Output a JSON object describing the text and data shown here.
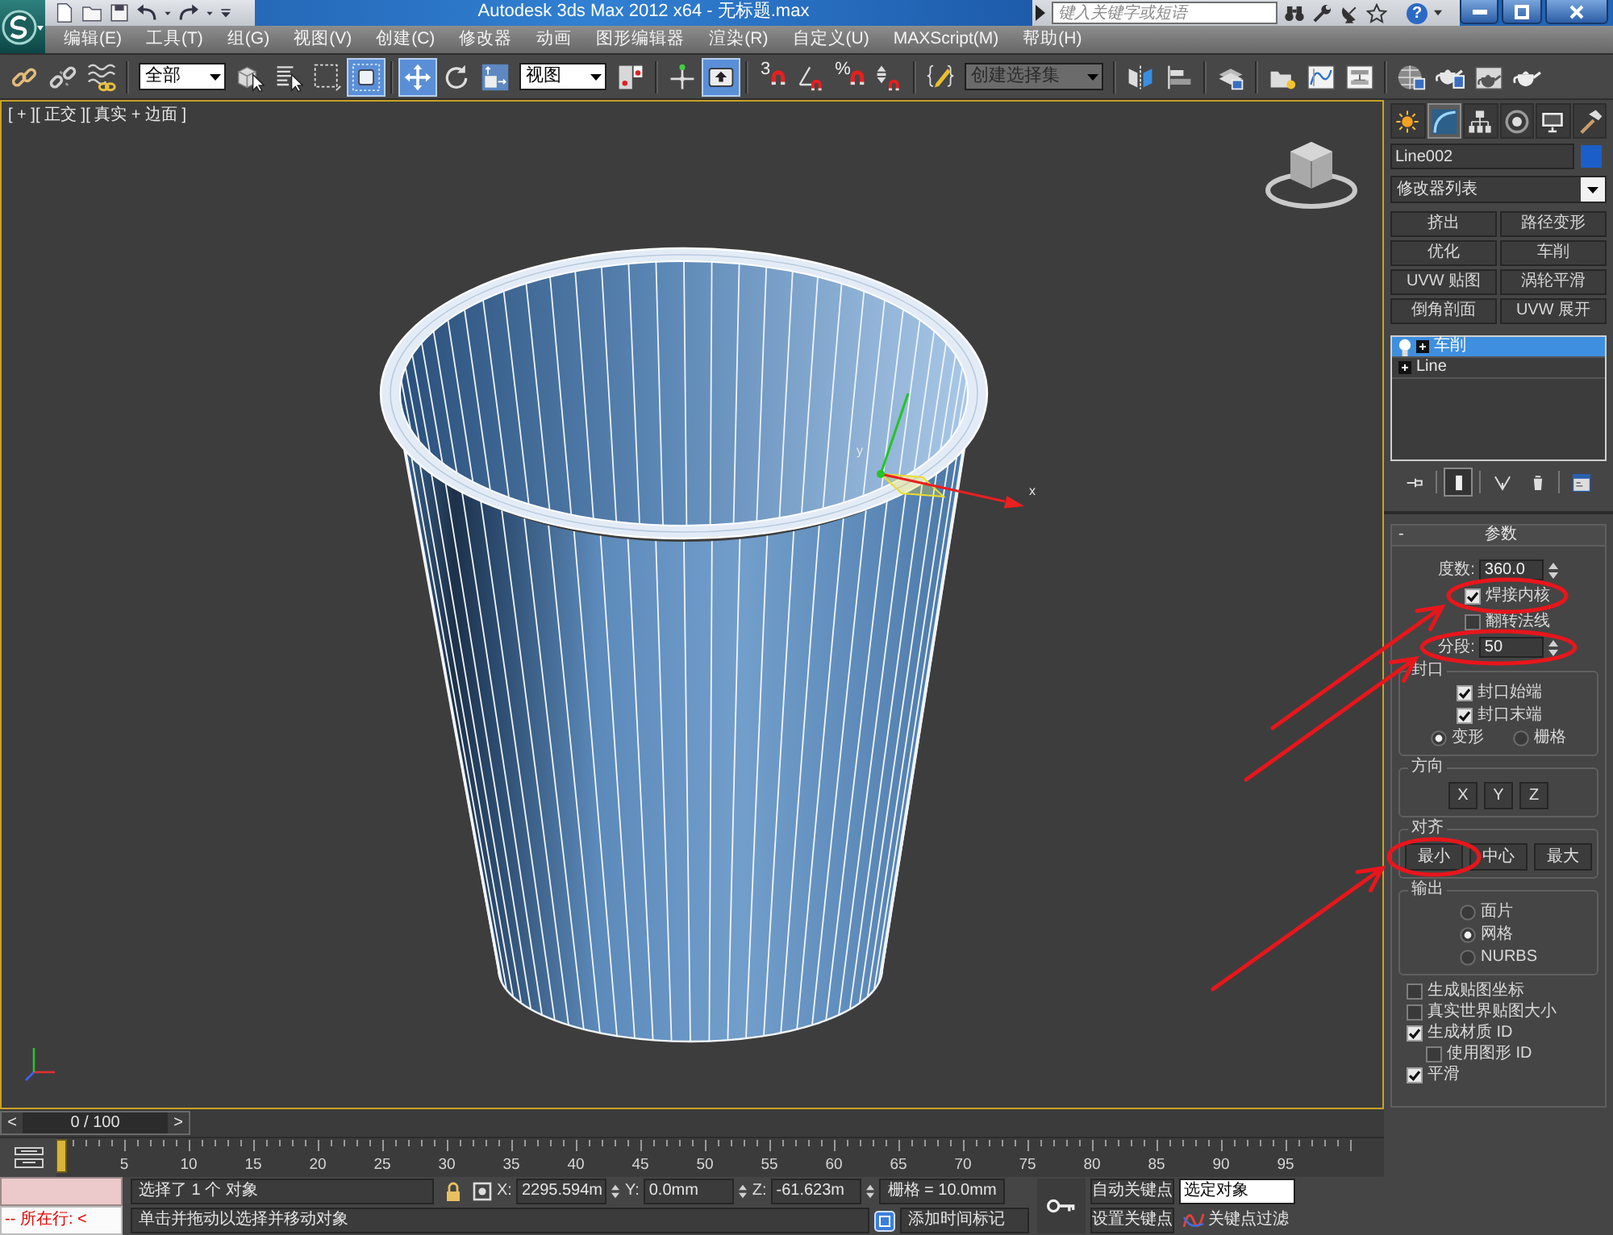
{
  "title_bar": {
    "title": "Autodesk 3ds Max  2012 x64 - 无标题.max",
    "search": {
      "placeholder": "键入关键字或短语"
    },
    "help": "?"
  },
  "menu": [
    "编辑(E)",
    "工具(T)",
    "组(G)",
    "视图(V)",
    "创建(C)",
    "修改器",
    "动画",
    "图形编辑器",
    "渲染(R)",
    "自定义(U)",
    "MAXScript(M)",
    "帮助(H)"
  ],
  "toolbar": {
    "groups": [
      [
        {
          "kind": "link",
          "on": false
        },
        {
          "kind": "unlink",
          "on": false
        },
        {
          "kind": "bind",
          "on": false
        }
      ],
      [
        {
          "kind": "dropdown",
          "value": "全部"
        },
        {
          "kind": "select",
          "on": false
        },
        {
          "kind": "select-by-name",
          "on": false
        },
        {
          "kind": "region",
          "on": false
        },
        {
          "kind": "window-crossing",
          "on": true
        }
      ],
      [
        {
          "kind": "move",
          "on": true
        },
        {
          "kind": "rotate",
          "on": false
        },
        {
          "kind": "scale",
          "on": false
        },
        {
          "kind": "dropdown",
          "value": "视图"
        },
        {
          "kind": "pivot",
          "on": false
        }
      ],
      [
        {
          "kind": "manipulate",
          "on": false
        },
        {
          "kind": "shortcut-override",
          "on": true
        }
      ],
      [
        {
          "kind": "snap",
          "label": "3",
          "on": false
        },
        {
          "kind": "angle-snap",
          "on": false
        },
        {
          "kind": "percent-snap",
          "label": "%",
          "on": false
        },
        {
          "kind": "spinner-snap",
          "on": false
        }
      ],
      [
        {
          "kind": "named-sets",
          "on": false
        },
        {
          "kind": "dropdown",
          "placeholder": "创建选择集"
        }
      ],
      [
        {
          "kind": "mirror",
          "on": false
        },
        {
          "kind": "align",
          "on": false
        }
      ],
      [
        {
          "kind": "layers",
          "on": false
        }
      ],
      [
        {
          "kind": "ribbon",
          "on": false
        },
        {
          "kind": "curve-editor",
          "on": false
        },
        {
          "kind": "schematic",
          "on": false
        }
      ],
      [
        {
          "kind": "material-editor",
          "on": false
        },
        {
          "kind": "render-setup",
          "on": false
        },
        {
          "kind": "frame-window",
          "on": false
        },
        {
          "kind": "render",
          "on": false
        }
      ]
    ]
  },
  "viewport": {
    "labels": [
      "[ + ]",
      "[ 正交 ]",
      "[ 真实 + 边面 ]"
    ],
    "gizmo_axes": [
      "x",
      "y"
    ]
  },
  "command_panel": {
    "tabs": [
      {
        "kind": "create",
        "selected": false
      },
      {
        "kind": "modify",
        "selected": true
      },
      {
        "kind": "hierarchy",
        "selected": false
      },
      {
        "kind": "motion",
        "selected": false
      },
      {
        "kind": "display",
        "selected": false
      },
      {
        "kind": "utilities",
        "selected": false
      }
    ],
    "object": {
      "name": "Line002",
      "color": "#1c5ec9"
    },
    "modifier_list": "修改器列表",
    "modifier_buttons": [
      "挤出",
      "路径变形",
      "优化",
      "车削",
      "UVW 贴图",
      "涡轮平滑",
      "倒角剖面",
      "UVW 展开"
    ],
    "stack": [
      {
        "kind": "modifier",
        "label": "车削",
        "selected": true,
        "expanded": false
      },
      {
        "kind": "object",
        "label": "Line",
        "selected": false,
        "expanded": false
      }
    ],
    "stack_tools": [
      {
        "kind": "pin",
        "on": false
      },
      {
        "kind": "end-result",
        "on": true
      },
      {
        "kind": "make-unique",
        "on": false
      },
      {
        "kind": "remove",
        "on": false
      },
      {
        "kind": "configure",
        "on": false
      }
    ],
    "rollout": {
      "toggle": "-",
      "title": "参数",
      "items": [
        {
          "kind": "spinner",
          "label": "度数:",
          "value": "360.0",
          "circled": false
        },
        {
          "kind": "checkbox",
          "label": "焊接内核",
          "checked": true,
          "circled": true
        },
        {
          "kind": "checkbox",
          "label": "翻转法线",
          "checked": false,
          "circled": false
        },
        {
          "kind": "spinner",
          "label": "分段:",
          "value": "50",
          "circled": true
        },
        {
          "kind": "group",
          "title": "封口",
          "items": [
            {
              "kind": "checkbox",
              "label": "封口始端",
              "checked": true,
              "circled": false
            },
            {
              "kind": "checkbox",
              "label": "封口末端",
              "checked": true,
              "circled": false
            },
            {
              "kind": "radio-row",
              "options": [
                {
                  "label": "变形",
                  "selected": true
                },
                {
                  "label": "栅格",
                  "selected": false
                }
              ]
            }
          ]
        },
        {
          "kind": "group",
          "title": "方向",
          "items": [
            {
              "kind": "buttons",
              "buttons": [
                {
                  "label": "X",
                  "circled": false
                },
                {
                  "label": "Y",
                  "circled": false
                },
                {
                  "label": "Z",
                  "circled": false
                }
              ]
            }
          ]
        },
        {
          "kind": "group",
          "title": "对齐",
          "items": [
            {
              "kind": "buttons",
              "buttons": [
                {
                  "label": "最小",
                  "circled": true
                },
                {
                  "label": "中心",
                  "circled": false
                },
                {
                  "label": "最大",
                  "circled": false
                }
              ]
            }
          ]
        },
        {
          "kind": "group",
          "title": "输出",
          "items": [
            {
              "kind": "radio",
              "label": "面片",
              "selected": false
            },
            {
              "kind": "radio",
              "label": "网格",
              "selected": true
            },
            {
              "kind": "radio",
              "label": "NURBS",
              "selected": false
            }
          ]
        },
        {
          "kind": "checkbox",
          "label": "生成贴图坐标",
          "checked": false,
          "circled": false
        },
        {
          "kind": "checkbox",
          "label": "真实世界贴图大小",
          "checked": false,
          "circled": false
        },
        {
          "kind": "checkbox",
          "label": "生成材质 ID",
          "checked": true,
          "circled": false,
          "children": [
            {
              "kind": "checkbox",
              "label": "使用图形 ID",
              "checked": false,
              "circled": false
            }
          ]
        },
        {
          "kind": "checkbox",
          "label": "平滑",
          "checked": true,
          "circled": false
        }
      ]
    }
  },
  "timeline": {
    "prev": "<",
    "position": "0 / 100",
    "next": ">",
    "level": 0,
    "frame_labels": [
      "5",
      "10",
      "15",
      "20",
      "25",
      "30",
      "35",
      "40",
      "45",
      "50",
      "55",
      "60",
      "65",
      "70",
      "75",
      "80",
      "85",
      "90",
      "95"
    ]
  },
  "status_bar": {
    "listener_output": "-- 所在行: <",
    "selection": "选择了 1 个 对象",
    "prompt": "单击并拖动以选择并移动对象",
    "coordinates": [
      {
        "label": "X:",
        "value": "2295.594m"
      },
      {
        "label": "Y:",
        "value": "0.0mm"
      },
      {
        "label": "Z:",
        "value": "-61.623m"
      }
    ],
    "grid": "栅格 = 10.0mm",
    "time_tag": "添加时间标记",
    "auto_key": "自动关键点",
    "set_key": "设置关键点",
    "key_mode": "选定对象",
    "key_filters": "关键点过滤"
  }
}
